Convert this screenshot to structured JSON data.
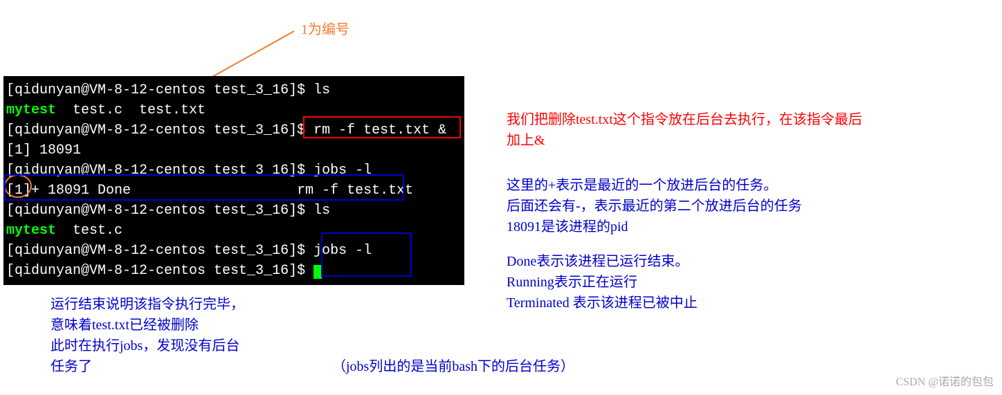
{
  "terminal": {
    "prompt1": "[qidunyan@VM-8-12-centos test_3_16]$ ls",
    "output1a": "mytest",
    "output1b": "  test.c  test.txt",
    "prompt2": "[qidunyan@VM-8-12-centos test_3_16]$ rm -f test.txt &",
    "jobnum": "[1] 18091",
    "prompt3": "[qidunyan@VM-8-12-centos test_3_16]$ jobs -l",
    "jobline": "[1]+ 18091 Done                    rm -f test.txt",
    "prompt4": "[qidunyan@VM-8-12-centos test_3_16]$ ls",
    "output4a": "mytest",
    "output4b": "  test.c",
    "prompt5": "[qidunyan@VM-8-12-centos test_3_16]$ jobs -l",
    "prompt6": "[qidunyan@VM-8-12-centos test_3_16]$ "
  },
  "notes": {
    "top_orange": "1为编号",
    "right_red": "我们把删除test.txt这个指令放在后台去执行，在该指令最后加上&",
    "right_blue_1": "这里的+表示是最近的一个放进后台的任务。",
    "right_blue_2": "后面还会有-，表示最近的第二个放进后台的任务",
    "right_blue_3": "18091是该进程的pid",
    "right_blue_4": "Done表示该进程已运行结束。",
    "right_blue_5": "Running表示正在运行",
    "right_blue_6": "Terminated 表示该进程已被中止",
    "bottom_left_1": "运行结束说明该指令执行完毕，",
    "bottom_left_2": "意味着test.txt已经被删除",
    "bottom_left_3": "此时在执行jobs，发现没有后台",
    "bottom_left_4": "任务了",
    "bottom_center": "（jobs列出的是当前bash下的后台任务）",
    "watermark": "CSDN @诺诺的包包"
  }
}
